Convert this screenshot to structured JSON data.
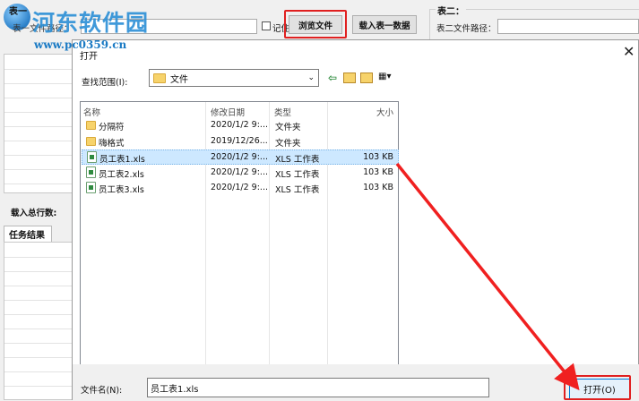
{
  "watermark": {
    "title": "河东软件园",
    "url": "www.pc0359.cn"
  },
  "app": {
    "table1_legend": "表一",
    "table1_path_label": "表一文件路径：",
    "remember_label": "记住",
    "browse_button": "浏览文件",
    "load_button": "载入表一数据",
    "table2_legend": "表二：",
    "table2_path_label": "表二文件路径：",
    "total_rows_label": "载入总行数:",
    "results_tab": "任务结果"
  },
  "dialog": {
    "title": "打开",
    "look_in_label": "查找范围(I):",
    "look_in_value": "文件",
    "columns": [
      "名称",
      "修改日期",
      "类型",
      "大小"
    ],
    "files": [
      {
        "name": "分隔符",
        "date": "2020/1/2 9:...",
        "type": "文件夹",
        "size": "",
        "kind": "folder",
        "selected": false
      },
      {
        "name": "嗨格式",
        "date": "2019/12/26...",
        "type": "文件夹",
        "size": "",
        "kind": "folder",
        "selected": false
      },
      {
        "name": "员工表1.xls",
        "date": "2020/1/2 9:...",
        "type": "XLS 工作表",
        "size": "103 KB",
        "kind": "xls",
        "selected": true
      },
      {
        "name": "员工表2.xls",
        "date": "2020/1/2 9:...",
        "type": "XLS 工作表",
        "size": "103 KB",
        "kind": "xls",
        "selected": false
      },
      {
        "name": "员工表3.xls",
        "date": "2020/1/2 9:...",
        "type": "XLS 工作表",
        "size": "103 KB",
        "kind": "xls",
        "selected": false
      }
    ],
    "filename_label": "文件名(N):",
    "filename_value": "员工表1.xls",
    "open_button": "打开(O)"
  },
  "colors": {
    "highlight_red": "#e02020",
    "selection_blue": "#cde8ff",
    "watermark_blue": "#2b8fd6",
    "arrow_red": "#f02020"
  }
}
